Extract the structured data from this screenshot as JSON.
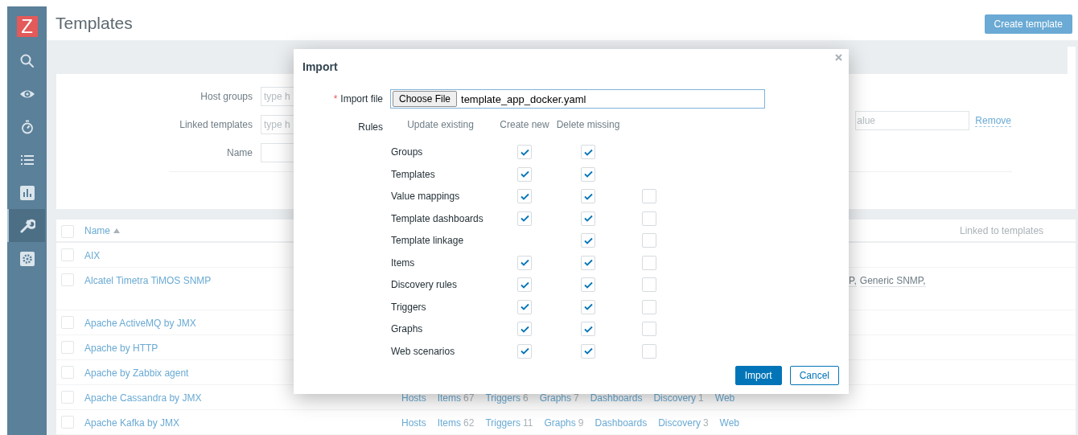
{
  "sidebar": {
    "logo": "Z",
    "items": [
      {
        "kind": "search",
        "selected": false
      },
      {
        "kind": "eye",
        "selected": false
      },
      {
        "kind": "stopwatch",
        "selected": false
      },
      {
        "kind": "list",
        "selected": false
      },
      {
        "kind": "chart",
        "selected": false
      },
      {
        "kind": "wrench",
        "selected": true
      },
      {
        "kind": "gear",
        "selected": false
      }
    ]
  },
  "header": {
    "title": "Templates",
    "create_button": "Create template"
  },
  "filter": {
    "fields": [
      {
        "label": "Host groups",
        "placeholder": "type h"
      },
      {
        "label": "Linked templates",
        "placeholder": "type h"
      },
      {
        "label": "Name"
      }
    ],
    "tag_value_placeholder": "alue",
    "remove_link": "Remove"
  },
  "table": {
    "all_checked": false,
    "columns": [
      {
        "label": "Name",
        "sort_ascending": true
      },
      {
        "label": "Linked to templates"
      }
    ],
    "rows": [
      {
        "name": "AIX",
        "checked": false
      },
      {
        "name": "Alcatel Timetra TiMOS SNMP",
        "checked": false,
        "linked_templates": [
          "P,",
          "Generic SNMP,"
        ]
      },
      {
        "name": "Apache ActiveMQ by JMX",
        "checked": false
      },
      {
        "name": "Apache by HTTP",
        "checked": false
      },
      {
        "name": "Apache by Zabbix agent",
        "checked": false
      },
      {
        "name": "Apache Cassandra by JMX",
        "checked": false,
        "links": [
          {
            "label": "Hosts"
          },
          {
            "label": "Items",
            "count": "67"
          },
          {
            "label": "Triggers",
            "count": "6"
          },
          {
            "label": "Graphs",
            "count": "7"
          },
          {
            "label": "Dashboards"
          },
          {
            "label": "Discovery",
            "count": "1"
          },
          {
            "label": "Web"
          }
        ]
      },
      {
        "name": "Apache Kafka by JMX",
        "checked": false,
        "links": [
          {
            "label": "Hosts"
          },
          {
            "label": "Items",
            "count": "62"
          },
          {
            "label": "Triggers",
            "count": "11"
          },
          {
            "label": "Graphs",
            "count": "9"
          },
          {
            "label": "Dashboards"
          },
          {
            "label": "Discovery",
            "count": "3"
          },
          {
            "label": "Web"
          }
        ]
      }
    ]
  },
  "dialog": {
    "title": "Import",
    "required_mark": "*",
    "file_label": "Import file",
    "choose_button": "Choose File",
    "file_name": "template_app_docker.yaml",
    "rules_label": "Rules",
    "rule_columns": [
      "Update existing",
      "Create new",
      "Delete missing"
    ],
    "rules": [
      {
        "label": "Groups",
        "update_existing": true,
        "create_new": true
      },
      {
        "label": "Templates",
        "update_existing": true,
        "create_new": true
      },
      {
        "label": "Value mappings",
        "update_existing": true,
        "create_new": true,
        "delete_missing": false
      },
      {
        "label": "Template dashboards",
        "update_existing": true,
        "create_new": true,
        "delete_missing": false
      },
      {
        "label": "Template linkage",
        "create_new": true,
        "delete_missing": false
      },
      {
        "label": "Items",
        "update_existing": true,
        "create_new": true,
        "delete_missing": false
      },
      {
        "label": "Discovery rules",
        "update_existing": true,
        "create_new": true,
        "delete_missing": false
      },
      {
        "label": "Triggers",
        "update_existing": true,
        "create_new": true,
        "delete_missing": false
      },
      {
        "label": "Graphs",
        "update_existing": true,
        "create_new": true,
        "delete_missing": false
      },
      {
        "label": "Web scenarios",
        "update_existing": true,
        "create_new": true,
        "delete_missing": false
      }
    ],
    "buttons": [
      {
        "label": "Import",
        "kind": "primary"
      },
      {
        "label": "Cancel",
        "kind": "secondary"
      }
    ]
  }
}
